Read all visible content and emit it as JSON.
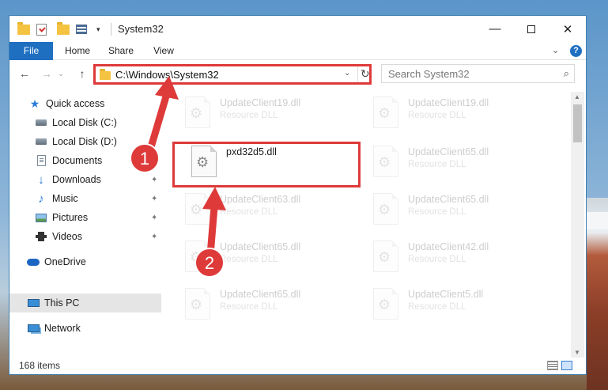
{
  "window": {
    "title": "System32",
    "quick_access_toolbar": [
      "folder-icon",
      "properties-icon",
      "new-folder-icon",
      "view-icon",
      "dropdown-icon"
    ],
    "controls": {
      "minimize": "—",
      "maximize": "",
      "close": "✕"
    }
  },
  "ribbon": {
    "tabs": [
      {
        "label": "File",
        "active": true
      },
      {
        "label": "Home"
      },
      {
        "label": "Share"
      },
      {
        "label": "View"
      }
    ],
    "expand_icon": "⌄",
    "help_label": "?"
  },
  "nav": {
    "back": "←",
    "forward": "→",
    "recent": "⌄",
    "up": "↑",
    "address": "C:\\Windows\\System32",
    "address_dropdown": "⌄",
    "refresh": "↻",
    "search_placeholder": "Search System32",
    "search_icon": "⌕"
  },
  "sidebar": {
    "items": [
      {
        "label": "Quick access",
        "icon": "star-icon",
        "pinned": false
      },
      {
        "label": "Local Disk (C:)",
        "icon": "disk-icon",
        "pinned": false
      },
      {
        "label": "Local Disk (D:)",
        "icon": "disk-icon",
        "pinned": false
      },
      {
        "label": "Documents",
        "icon": "document-icon",
        "pinned": true
      },
      {
        "label": "Downloads",
        "icon": "download-icon",
        "pinned": true
      },
      {
        "label": "Music",
        "icon": "music-icon",
        "pinned": true
      },
      {
        "label": "Pictures",
        "icon": "pictures-icon",
        "pinned": true
      },
      {
        "label": "Videos",
        "icon": "videos-icon",
        "pinned": true
      },
      {
        "label": "OneDrive",
        "icon": "onedrive-icon",
        "pinned": false
      },
      {
        "label": "This PC",
        "icon": "this-pc-icon",
        "pinned": false,
        "selected": true
      },
      {
        "label": "Network",
        "icon": "network-icon",
        "pinned": false
      }
    ],
    "pin_glyph": "📌"
  },
  "files": {
    "left": [
      {
        "name": "UpdateClient19.dll",
        "type": "Resource DLL",
        "faded": true
      },
      {
        "name": "pxd32d5.dll",
        "type": "",
        "faded": false
      },
      {
        "name": "UpdateClient63.dll",
        "type": "Resource DLL",
        "faded": true
      },
      {
        "name": "UpdateClient65.dll",
        "type": "Resource DLL",
        "faded": true
      },
      {
        "name": "UpdateClient65.dll",
        "type": "Resource DLL",
        "faded": true
      }
    ],
    "right": [
      {
        "name": "UpdateClient19.dll",
        "type": "Resource DLL",
        "faded": true
      },
      {
        "name": "UpdateClient65.dll",
        "type": "Resource DLL",
        "faded": true
      },
      {
        "name": "UpdateClient65.dll",
        "type": "Resource DLL",
        "faded": true
      },
      {
        "name": "UpdateClient42.dll",
        "type": "Resource DLL",
        "faded": true
      },
      {
        "name": "UpdateClient5.dll",
        "type": "Resource DLL",
        "faded": true
      }
    ]
  },
  "status": {
    "item_count": "168 items"
  },
  "annotations": {
    "step1": "1",
    "step2": "2",
    "color": "#de3a3a"
  }
}
